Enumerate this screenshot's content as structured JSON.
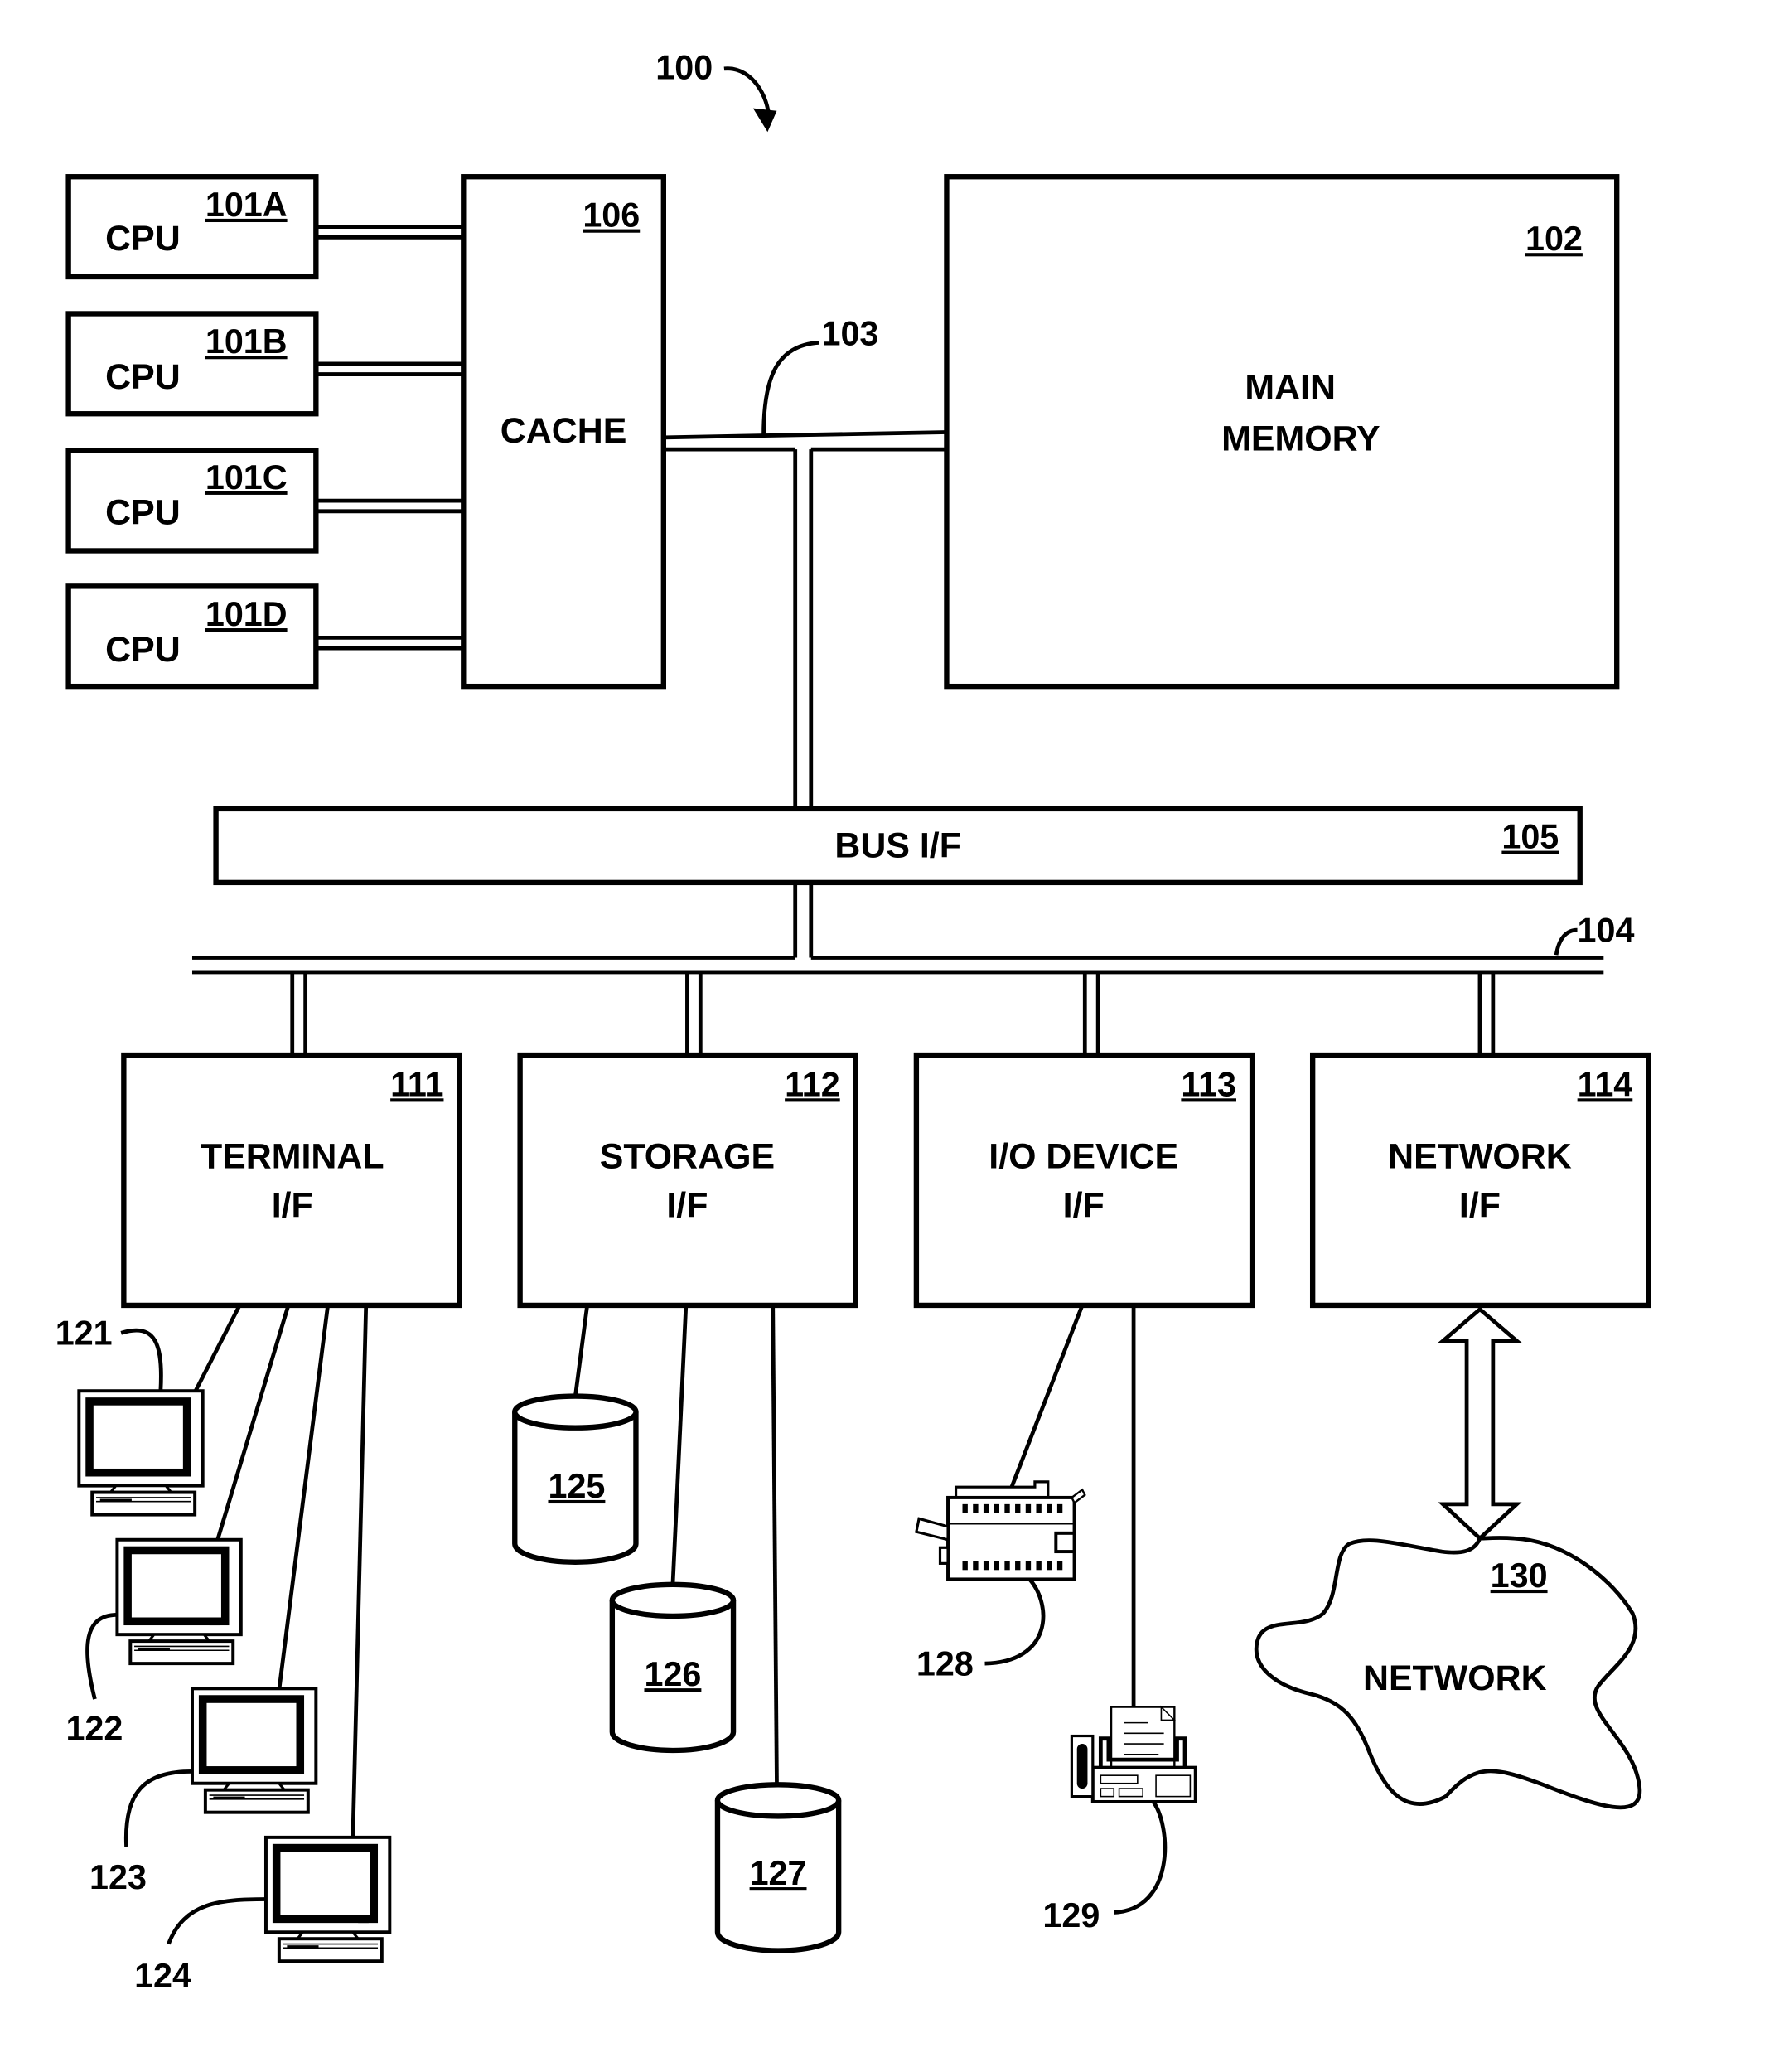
{
  "figure": {
    "reference": "100",
    "title_ref": "100"
  },
  "cpus": [
    {
      "label": "CPU",
      "ref": "101A"
    },
    {
      "label": "CPU",
      "ref": "101B"
    },
    {
      "label": "CPU",
      "ref": "101C"
    },
    {
      "label": "CPU",
      "ref": "101D"
    }
  ],
  "cache": {
    "label": "CACHE",
    "ref": "106"
  },
  "main_memory": {
    "label_line1": "MAIN",
    "label_line2": "MEMORY",
    "ref": "102"
  },
  "memory_bus": {
    "ref": "103"
  },
  "bus_interface": {
    "label": "BUS I/F",
    "ref": "105"
  },
  "io_bus": {
    "ref": "104"
  },
  "interfaces": [
    {
      "line1": "TERMINAL",
      "line2": "I/F",
      "ref": "111"
    },
    {
      "line1": "STORAGE",
      "line2": "I/F",
      "ref": "112"
    },
    {
      "line1": "I/O DEVICE",
      "line2": "I/F",
      "ref": "113"
    },
    {
      "line1": "NETWORK",
      "line2": "I/F",
      "ref": "114"
    }
  ],
  "terminals": [
    {
      "ref": "121",
      "icon": "computer-terminal-icon"
    },
    {
      "ref": "122",
      "icon": "computer-terminal-icon"
    },
    {
      "ref": "123",
      "icon": "computer-terminal-icon"
    },
    {
      "ref": "124",
      "icon": "computer-terminal-icon"
    }
  ],
  "storage_devices": [
    {
      "ref": "125",
      "icon": "disk-cylinder-icon"
    },
    {
      "ref": "126",
      "icon": "disk-cylinder-icon"
    },
    {
      "ref": "127",
      "icon": "disk-cylinder-icon"
    }
  ],
  "io_devices": [
    {
      "ref": "128",
      "icon": "printer-icon"
    },
    {
      "ref": "129",
      "icon": "fax-machine-icon"
    }
  ],
  "network": {
    "label": "NETWORK",
    "ref": "130",
    "icon": "cloud-icon"
  }
}
